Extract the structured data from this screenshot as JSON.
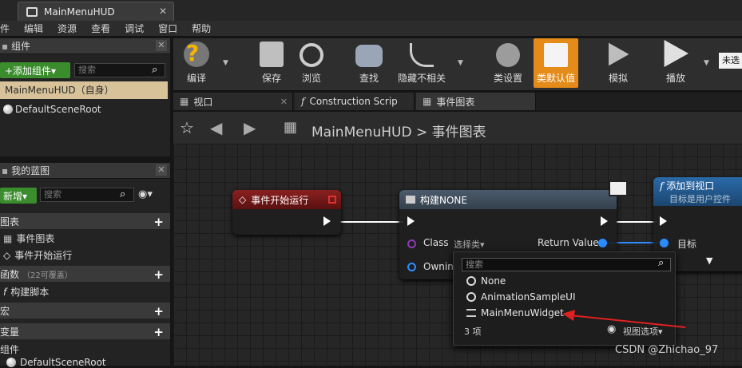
{
  "window": {
    "tab_title": "MainMenuHUD"
  },
  "menu": [
    "件",
    "编辑",
    "资源",
    "查看",
    "调试",
    "窗口",
    "帮助"
  ],
  "components": {
    "header": "组件",
    "add_button": "+添加组件▾",
    "search_placeholder": "搜索",
    "self_label": "MainMenuHUD（自身）",
    "root_item": "DefaultSceneRoot"
  },
  "my_blueprint": {
    "header": "我的蓝图",
    "new_button": "新增▾",
    "search_placeholder": "搜索",
    "graphs_label": "图表",
    "event_graph": "事件图表",
    "begin_play": "事件开始运行",
    "functions_label": "函数",
    "functions_hint": "（22可覆盖）",
    "construct_script": "构建脚本",
    "macros_label": "宏",
    "variables_label": "变量",
    "components_sub": "组件",
    "root_item": "DefaultSceneRoot"
  },
  "toolbar": {
    "compile": "编译",
    "save": "保存",
    "browse": "浏览",
    "find": "查找",
    "hide_unrelated": "隐藏不相关",
    "class_settings": "类设置",
    "class_defaults": "类默认值",
    "simulate": "模拟",
    "play": "播放",
    "debug_select": "未选"
  },
  "doc_tabs": [
    "视口",
    "Construction Scrip",
    "事件图表"
  ],
  "breadcrumb": {
    "root": "MainMenuHUD",
    "sep": ">",
    "current": "事件图表"
  },
  "nodes": {
    "begin_play": {
      "title": "事件开始运行"
    },
    "construct": {
      "title": "构建NONE",
      "class_pin": "Class",
      "class_value": "选择类▾",
      "owning_pin": "Owning",
      "return_pin": "Return Value"
    },
    "add_to_viewport": {
      "title": "添加到视口",
      "subtitle": "目标是用户控件",
      "target_pin": "目标"
    }
  },
  "class_picker": {
    "search_placeholder": "搜索",
    "options": [
      "None",
      "AnimationSampleUI",
      "MainMenuWidget"
    ],
    "count": "3 项",
    "view_options": "视图选项▾"
  },
  "watermark": "CSDN @Zhichao_97",
  "colors": {
    "accent_orange": "#e48b1a",
    "add_green": "#3a8c2c",
    "event_red": "#7a1c1c",
    "arrow_red": "#e02020"
  }
}
